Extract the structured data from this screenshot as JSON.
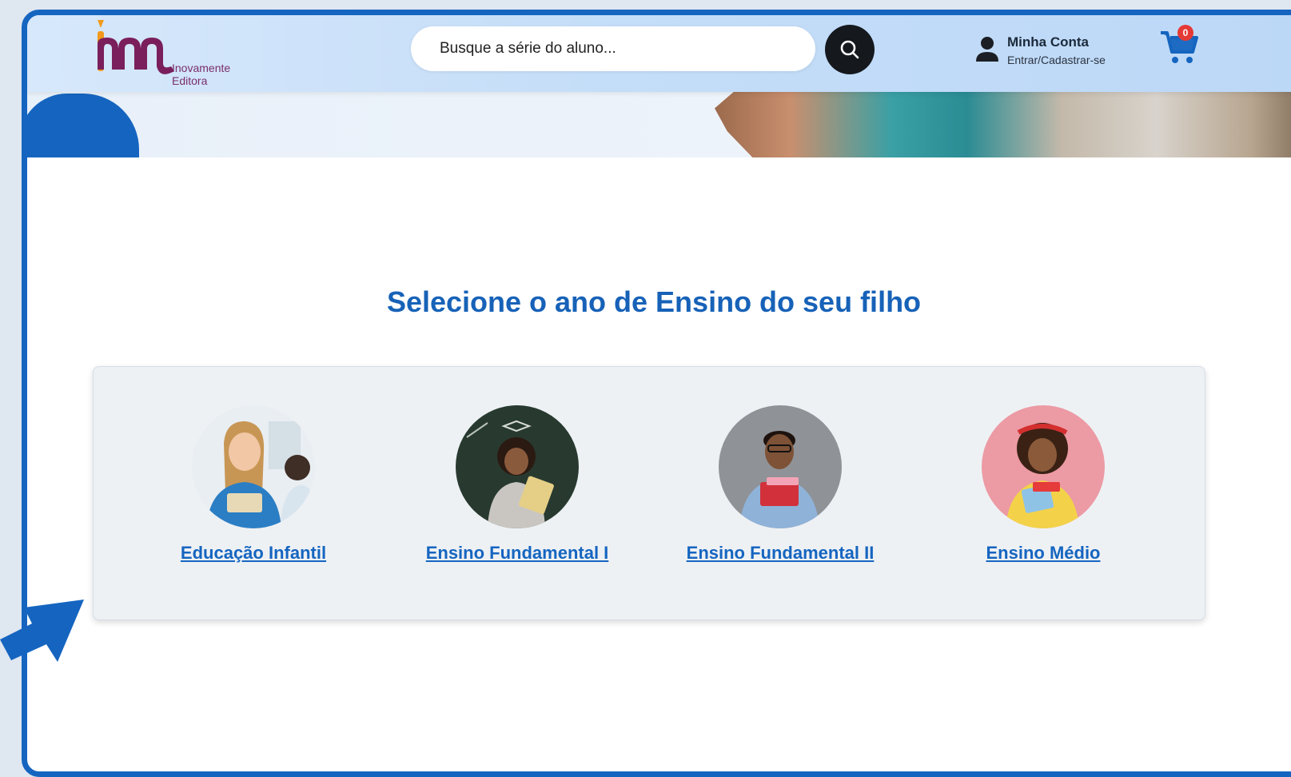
{
  "brand": {
    "logo_name": "Inovamente",
    "logo_sub": "Editora",
    "colors": {
      "primary": "#1565c0",
      "brand_purple": "#7a1f5c",
      "brand_orange": "#f29a1d"
    }
  },
  "header": {
    "search": {
      "placeholder": "Busque a série do aluno..."
    },
    "account": {
      "title": "Minha Conta",
      "subtitle": "Entrar/Cadastrar-se"
    },
    "cart": {
      "count": "0"
    }
  },
  "main": {
    "heading": "Selecione o ano de Ensino do seu filho",
    "levels": [
      {
        "label": "Educação Infantil",
        "avatar": "child-avatar-1"
      },
      {
        "label": "Ensino Fundamental I",
        "avatar": "child-avatar-2"
      },
      {
        "label": "Ensino Fundamental II",
        "avatar": "child-avatar-3"
      },
      {
        "label": "Ensino Médio",
        "avatar": "child-avatar-4"
      }
    ]
  }
}
